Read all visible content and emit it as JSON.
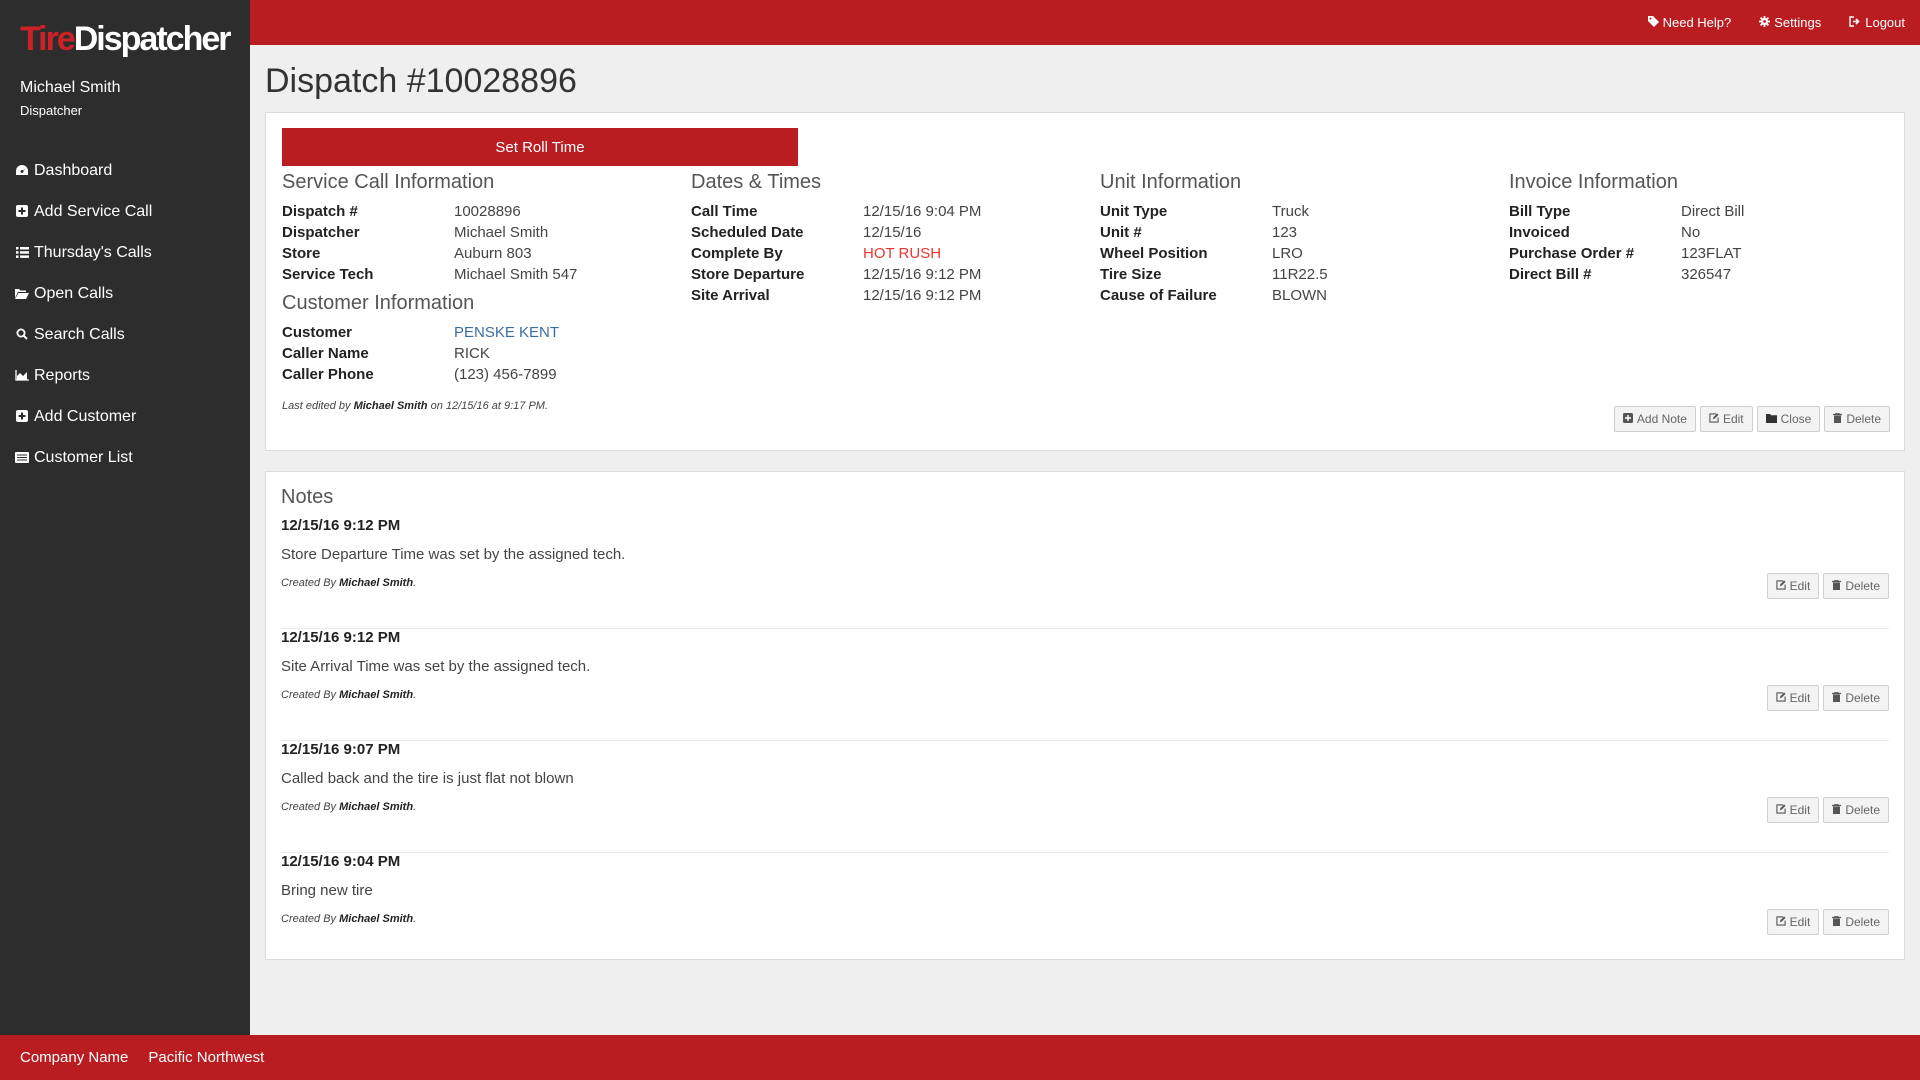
{
  "app": {
    "logo_part1": "Tire",
    "logo_part2": "Dispatcher"
  },
  "user": {
    "name": "Michael Smith",
    "role": "Dispatcher"
  },
  "nav": [
    {
      "label": "Dashboard",
      "icon": "dashboard-icon"
    },
    {
      "label": "Add Service Call",
      "icon": "plus-square-icon"
    },
    {
      "label": "Thursday's Calls",
      "icon": "list-icon"
    },
    {
      "label": "Open Calls",
      "icon": "folder-open-icon"
    },
    {
      "label": "Search Calls",
      "icon": "search-icon"
    },
    {
      "label": "Reports",
      "icon": "area-chart-icon"
    },
    {
      "label": "Add Customer",
      "icon": "plus-square-icon"
    },
    {
      "label": "Customer List",
      "icon": "list-alt-icon"
    }
  ],
  "topbar": {
    "help": "Need Help?",
    "settings": "Settings",
    "logout": "Logout"
  },
  "page": {
    "title": "Dispatch #10028896",
    "roll_button": "Set Roll Time"
  },
  "service_info": {
    "heading": "Service Call Information",
    "rows": [
      {
        "k": "Dispatch #",
        "v": "10028896"
      },
      {
        "k": "Dispatcher",
        "v": "Michael Smith"
      },
      {
        "k": "Store",
        "v": "Auburn 803"
      },
      {
        "k": "Service Tech",
        "v": "Michael Smith 547"
      }
    ]
  },
  "customer_info": {
    "heading": "Customer Information",
    "rows": [
      {
        "k": "Customer",
        "v": "PENSKE KENT"
      },
      {
        "k": "Caller Name",
        "v": "RICK"
      },
      {
        "k": "Caller Phone",
        "v": "(123) 456-7899"
      }
    ]
  },
  "dates": {
    "heading": "Dates & Times",
    "rows": [
      {
        "k": "Call Time",
        "v": "12/15/16 9:04 PM"
      },
      {
        "k": "Scheduled Date",
        "v": "12/15/16"
      },
      {
        "k": "Complete By",
        "v": "HOT RUSH"
      },
      {
        "k": "Store Departure",
        "v": "12/15/16 9:12 PM"
      },
      {
        "k": "Site Arrival",
        "v": "12/15/16 9:12 PM"
      }
    ]
  },
  "unit_info": {
    "heading": "Unit Information",
    "rows": [
      {
        "k": "Unit Type",
        "v": "Truck"
      },
      {
        "k": "Unit #",
        "v": "123"
      },
      {
        "k": "Wheel Position",
        "v": "LRO"
      },
      {
        "k": "Tire Size",
        "v": "11R22.5"
      },
      {
        "k": "Cause of Failure",
        "v": "BLOWN"
      }
    ]
  },
  "invoice_info": {
    "heading": "Invoice Information",
    "rows": [
      {
        "k": "Bill Type",
        "v": "Direct Bill"
      },
      {
        "k": "Invoiced",
        "v": "No"
      },
      {
        "k": "Purchase Order #",
        "v": "123FLAT"
      },
      {
        "k": "Direct Bill #",
        "v": "326547"
      }
    ]
  },
  "edited": {
    "prefix": "Last edited by",
    "by": "Michael Smith",
    "suffix": "on 12/15/16 at 9:17 PM."
  },
  "panel_actions": {
    "add_note": "Add Note",
    "edit": "Edit",
    "close": "Close",
    "delete": "Delete"
  },
  "notes": {
    "title": "Notes",
    "created_prefix": "Created By",
    "edit": "Edit",
    "delete": "Delete",
    "items": [
      {
        "date": "12/15/16 9:12 PM",
        "text": "Store Departure Time was set by the assigned tech.",
        "by": "Michael Smith"
      },
      {
        "date": "12/15/16 9:12 PM",
        "text": "Site Arrival Time was set by the assigned tech.",
        "by": "Michael Smith"
      },
      {
        "date": "12/15/16 9:07 PM",
        "text": "Called back and the tire is just flat not blown",
        "by": "Michael Smith"
      },
      {
        "date": "12/15/16 9:04 PM",
        "text": "Bring new tire",
        "by": "Michael Smith"
      }
    ]
  },
  "footer": {
    "company": "Company Name",
    "region": "Pacific Northwest"
  },
  "colors": {
    "brand_red": "#b91d22",
    "sidebar": "#2d2d2d",
    "hot_rush": "#e8382f",
    "link": "#3b6ea0"
  }
}
